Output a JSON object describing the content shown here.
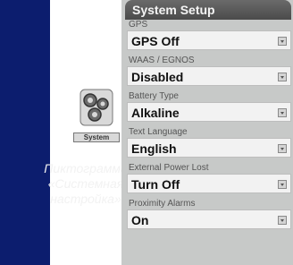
{
  "caption": {
    "line1": "Пиктограмма",
    "line2": "«Системная",
    "line3": "настройка»"
  },
  "app_icon": {
    "icon_name": "gears-icon",
    "label": "System"
  },
  "screen": {
    "title": "System Setup",
    "settings": [
      {
        "label": "GPS",
        "value": "GPS Off"
      },
      {
        "label": "WAAS / EGNOS",
        "value": "Disabled"
      },
      {
        "label": "Battery Type",
        "value": "Alkaline"
      },
      {
        "label": "Text Language",
        "value": "English"
      },
      {
        "label": "External Power Lost",
        "value": "Turn Off"
      },
      {
        "label": "Proximity Alarms",
        "value": "On"
      }
    ]
  },
  "colors": {
    "background": "#0c1d6e",
    "device_body": "#c7c9c8",
    "title_bar": "#555555"
  }
}
